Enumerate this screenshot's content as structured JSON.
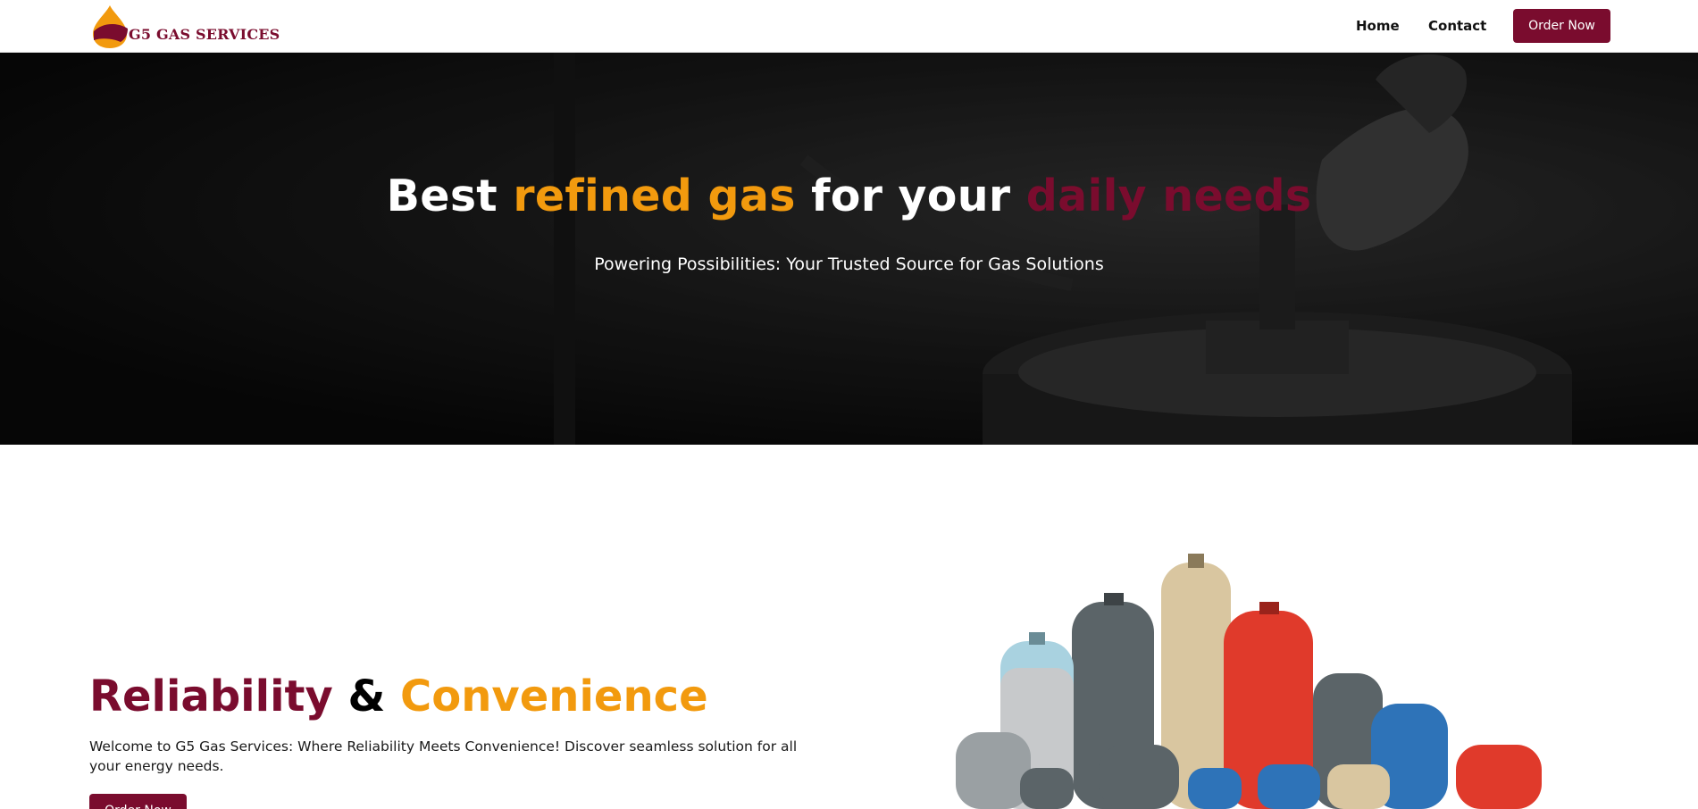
{
  "navbar": {
    "brand_name": "G5 GAS SERVICES",
    "links": [
      {
        "label": "Home"
      },
      {
        "label": "Contact"
      }
    ],
    "order_button": "Order Now"
  },
  "hero": {
    "title_parts": [
      "Best ",
      "refined gas",
      " for your ",
      "daily needs"
    ],
    "subtitle": "Powering Possibilities: Your Trusted Source for Gas Solutions"
  },
  "about": {
    "title_parts": [
      "Reliability",
      " & ",
      "Convenience"
    ],
    "text": "Welcome to G5 Gas Services: Where Reliability Meets Convenience! Discover seamless solution for all your energy needs.",
    "order_button": "Order Now"
  },
  "colors": {
    "brand_maroon": "#7a0c2e",
    "accent_orange": "#f29a0e"
  },
  "icons": {
    "logo": "gas-flame-logo-icon"
  }
}
